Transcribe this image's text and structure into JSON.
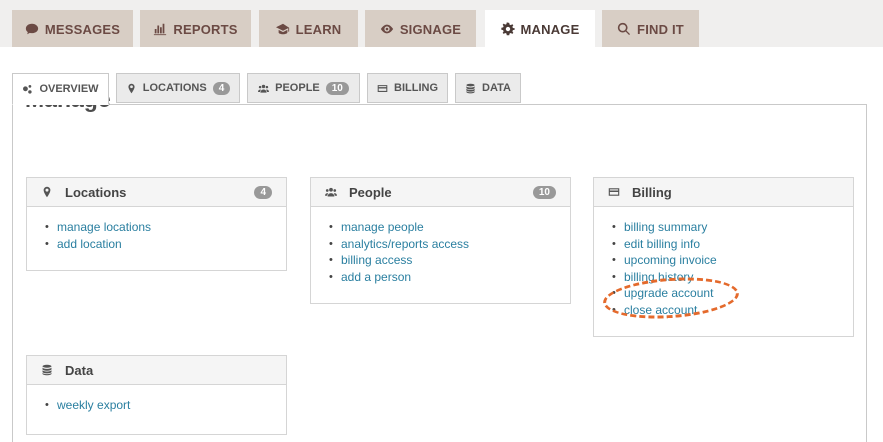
{
  "top_nav": {
    "messages": "MESSAGES",
    "reports": "REPORTS",
    "learn": "LEARN",
    "signage": "SIGNAGE",
    "manage": "MANAGE",
    "find_it": "FIND IT"
  },
  "sub_tabs": {
    "overview": "OVERVIEW",
    "locations": "LOCATIONS",
    "locations_count": "4",
    "people": "PEOPLE",
    "people_count": "10",
    "billing": "BILLING",
    "data": "DATA"
  },
  "page_title": "Manage",
  "cards": {
    "locations": {
      "title": "Locations",
      "count": "4",
      "links": [
        "manage locations",
        "add location"
      ]
    },
    "people": {
      "title": "People",
      "count": "10",
      "links": [
        "manage people",
        "analytics/reports access",
        "billing access",
        "add a person"
      ]
    },
    "billing": {
      "title": "Billing",
      "links": [
        "billing summary",
        "edit billing info",
        "upcoming invoice",
        "billing history",
        "upgrade account",
        "close account"
      ]
    },
    "data": {
      "title": "Data",
      "links": [
        "weekly export"
      ]
    }
  },
  "colors": {
    "accent_link": "#2a7fa0",
    "annotation": "#e46a2c",
    "tab_bg": "#d8cec5"
  }
}
